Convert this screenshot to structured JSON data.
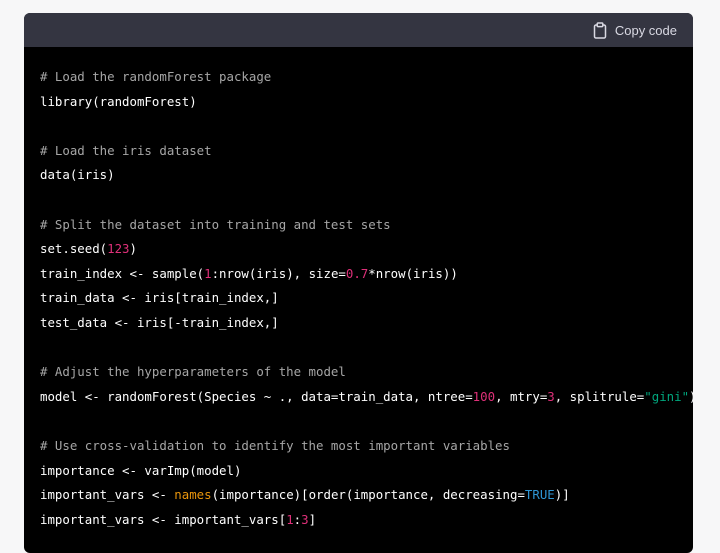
{
  "header": {
    "copy_label": "Copy code",
    "copy_icon": "clipboard-icon"
  },
  "colors": {
    "background": "#000000",
    "header": "#343541",
    "comment": "#a6a6a6",
    "number": "#df3079",
    "string": "#00a67d",
    "builtin": "#e9950c",
    "constant": "#2e95d3"
  },
  "code": {
    "lines": [
      [
        {
          "t": "# Load the randomForest package",
          "k": "c"
        }
      ],
      [
        {
          "t": "library(randomForest)"
        }
      ],
      [],
      [
        {
          "t": "# Load the iris dataset",
          "k": "c"
        }
      ],
      [
        {
          "t": "data(iris)"
        }
      ],
      [],
      [
        {
          "t": "# Split the dataset into training and test sets",
          "k": "c"
        }
      ],
      [
        {
          "t": "set.seed("
        },
        {
          "t": "123",
          "k": "n"
        },
        {
          "t": ")"
        }
      ],
      [
        {
          "t": "train_index <- sample("
        },
        {
          "t": "1",
          "k": "n"
        },
        {
          "t": ":nrow(iris), size="
        },
        {
          "t": "0.7",
          "k": "n"
        },
        {
          "t": "*nrow(iris))"
        }
      ],
      [
        {
          "t": "train_data <- iris[train_index,]"
        }
      ],
      [
        {
          "t": "test_data <- iris[-train_index,]"
        }
      ],
      [],
      [
        {
          "t": "# Adjust the hyperparameters of the model",
          "k": "c"
        }
      ],
      [
        {
          "t": "model <- randomForest(Species ~ ., data=train_data, ntree="
        },
        {
          "t": "100",
          "k": "n"
        },
        {
          "t": ", mtry="
        },
        {
          "t": "3",
          "k": "n"
        },
        {
          "t": ", splitrule="
        },
        {
          "t": "\"gini\"",
          "k": "s"
        },
        {
          "t": ")"
        }
      ],
      [],
      [
        {
          "t": "# Use cross-validation to identify the most important variables",
          "k": "c"
        }
      ],
      [
        {
          "t": "importance <- varImp(model)"
        }
      ],
      [
        {
          "t": "important_vars <- "
        },
        {
          "t": "names",
          "k": "b"
        },
        {
          "t": "(importance)[order(importance, decreasing="
        },
        {
          "t": "TRUE",
          "k": "k"
        },
        {
          "t": ")]"
        }
      ],
      [
        {
          "t": "important_vars <- important_vars["
        },
        {
          "t": "1",
          "k": "n"
        },
        {
          "t": ":"
        },
        {
          "t": "3",
          "k": "n"
        },
        {
          "t": "]"
        }
      ]
    ]
  }
}
